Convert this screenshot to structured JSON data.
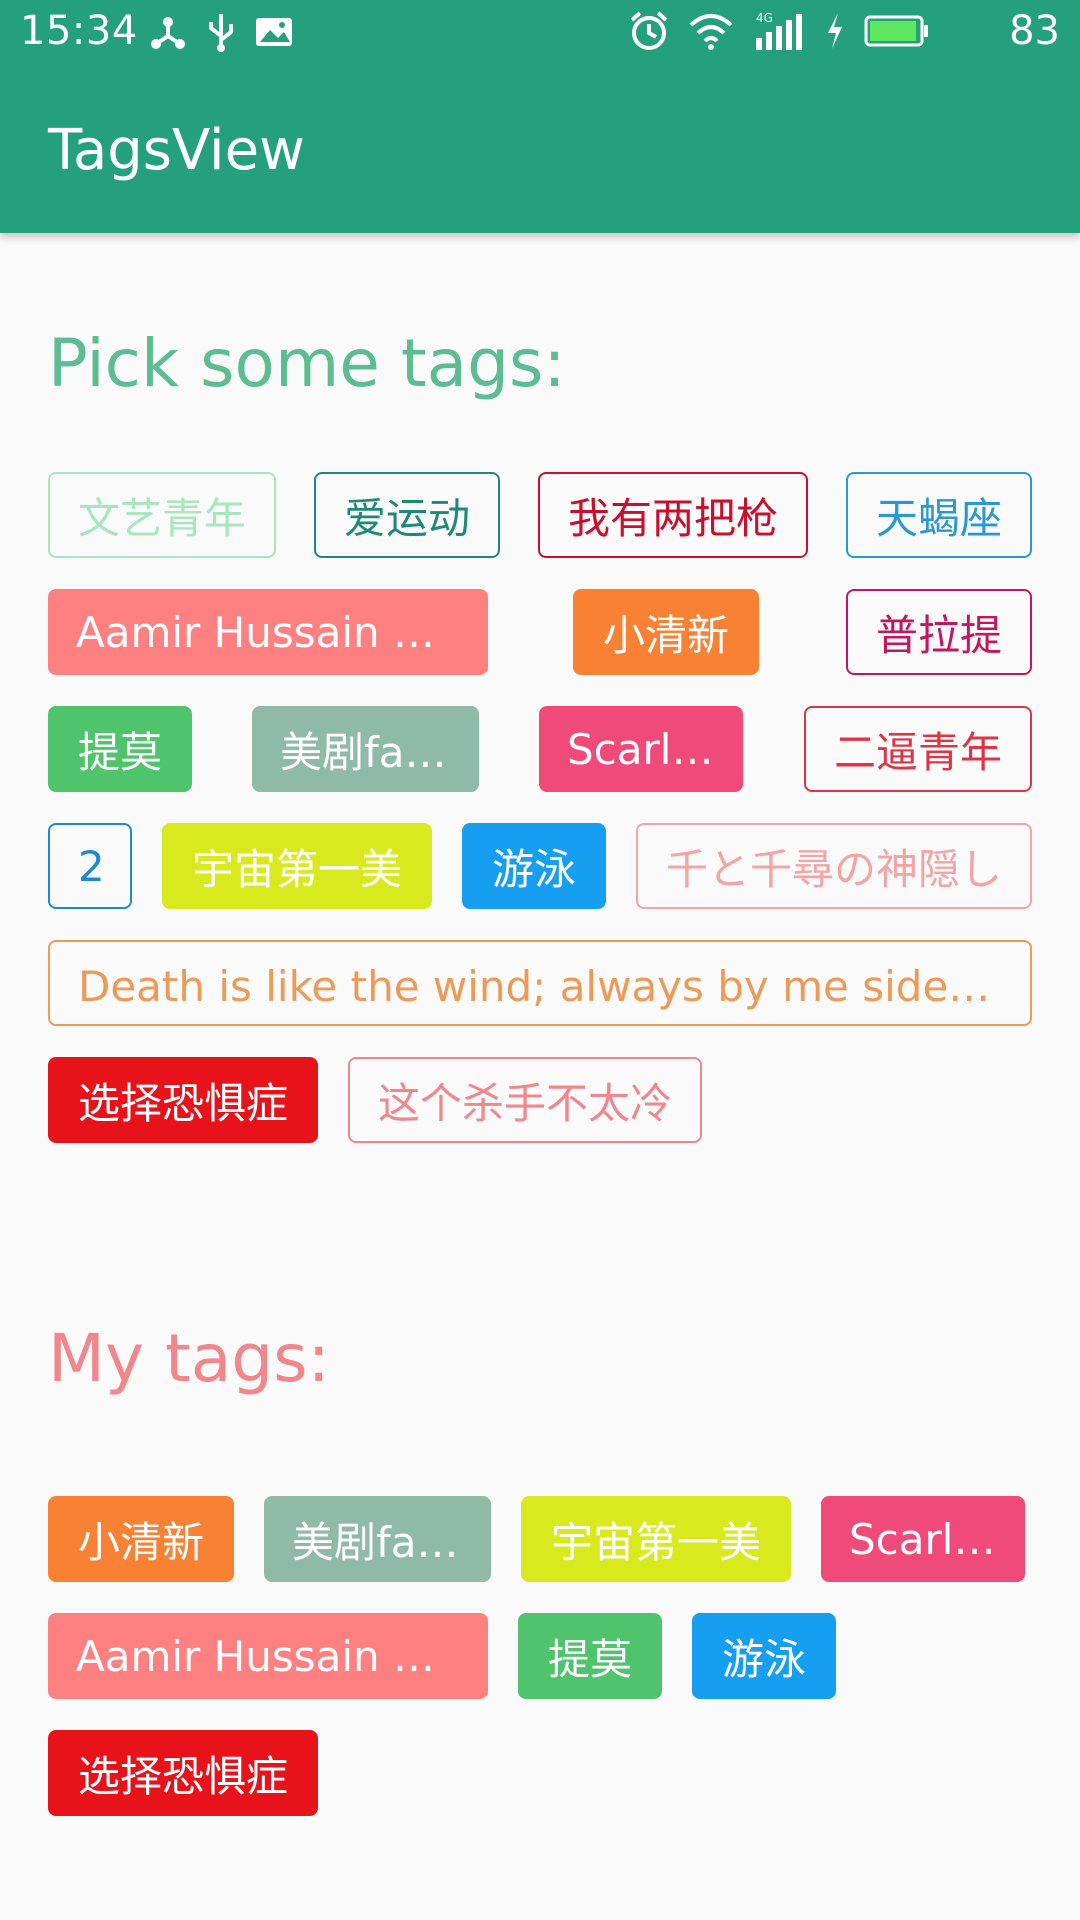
{
  "status_bar": {
    "time": "15:34",
    "battery_percent": "83",
    "icons_left": [
      "network-share-icon",
      "usb-icon",
      "image-icon"
    ],
    "icons_right": [
      "alarm-icon",
      "wifi-icon",
      "signal-4g-icon",
      "charging-icon",
      "battery-icon"
    ]
  },
  "app_bar": {
    "title": "TagsView",
    "color": "#24a07c"
  },
  "pick_section": {
    "title": "Pick some tags:",
    "tags": [
      {
        "label": "文艺青年",
        "style": "outline",
        "color": "#a8e6bd"
      },
      {
        "label": "爱运动",
        "style": "outline",
        "color": "#1f8a73"
      },
      {
        "label": "我有两把枪",
        "style": "outline",
        "color": "#c8102e"
      },
      {
        "label": "天蝎座",
        "style": "outline",
        "color": "#2b98d6"
      },
      {
        "label": "Aamir Hussain Khan",
        "style": "filled",
        "color": "#ff8080"
      },
      {
        "label": "小清新",
        "style": "filled",
        "color": "#f98134"
      },
      {
        "label": "普拉提",
        "style": "outline",
        "color": "#c2185b"
      },
      {
        "label": "提莫",
        "style": "filled",
        "color": "#4fc46c"
      },
      {
        "label": "美剧fans",
        "style": "filled",
        "color": "#8fbaa8"
      },
      {
        "label": "Scarlett",
        "style": "filled",
        "color": "#f04a7a"
      },
      {
        "label": "二逼青年",
        "style": "outline",
        "color": "#dc3545"
      },
      {
        "label": "2",
        "style": "outline",
        "color": "#1e88d6"
      },
      {
        "label": "宇宙第一美",
        "style": "filled",
        "color": "#d8ea1e"
      },
      {
        "label": "游泳",
        "style": "filled",
        "color": "#169ff0"
      },
      {
        "label": "千と千尋の神隠し",
        "style": "outline",
        "color": "#f3a5a5"
      },
      {
        "label": "Death is like the wind; always by me side. 死亡...",
        "style": "outline",
        "color": "#ee9a57"
      },
      {
        "label": "选择恐惧症",
        "style": "filled",
        "color": "#e8121a"
      },
      {
        "label": "这个杀手不太冷",
        "style": "outline",
        "color": "#f1868c"
      }
    ]
  },
  "my_section": {
    "title": "My tags:",
    "tags": [
      {
        "label": "小清新",
        "style": "filled",
        "color": "#f98134"
      },
      {
        "label": "美剧fans",
        "style": "filled",
        "color": "#8fbaa8"
      },
      {
        "label": "宇宙第一美",
        "style": "filled",
        "color": "#d8ea1e"
      },
      {
        "label": "Scarlett",
        "style": "filled",
        "color": "#f04a7a"
      },
      {
        "label": "Aamir Hussain Khan",
        "style": "filled",
        "color": "#ff8080"
      },
      {
        "label": "提莫",
        "style": "filled",
        "color": "#4fc46c"
      },
      {
        "label": "游泳",
        "style": "filled",
        "color": "#169ff0"
      },
      {
        "label": "选择恐惧症",
        "style": "filled",
        "color": "#e8121a"
      }
    ]
  }
}
